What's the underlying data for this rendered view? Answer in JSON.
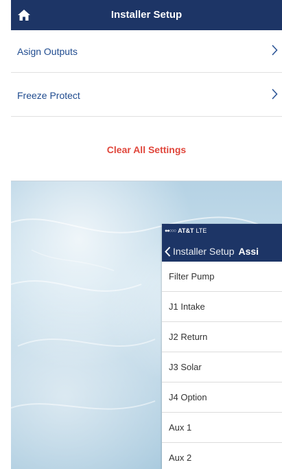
{
  "header": {
    "title": "Installer Setup",
    "home_icon": "home-icon",
    "bg_color": "#1d3566"
  },
  "menu": {
    "items": [
      {
        "label": "Asign Outputs",
        "icon": "chevron-right-icon"
      },
      {
        "label": "Freeze Protect",
        "icon": "chevron-right-icon"
      }
    ],
    "clear_all_label": "Clear All Settings",
    "clear_color": "#e0463b",
    "link_color": "#1f4b8f"
  },
  "overlay_phone": {
    "status": {
      "signal_bars": "●●○○○",
      "carrier": "AT&T",
      "network": "LTE"
    },
    "nav": {
      "back_label": "Installer Setup",
      "title": "Assi"
    },
    "items": [
      {
        "label": "Filter Pump"
      },
      {
        "label": "J1 Intake"
      },
      {
        "label": "J2 Return"
      },
      {
        "label": "J3 Solar"
      },
      {
        "label": "J4 Option"
      },
      {
        "label": "Aux 1"
      },
      {
        "label": "Aux 2"
      }
    ]
  }
}
